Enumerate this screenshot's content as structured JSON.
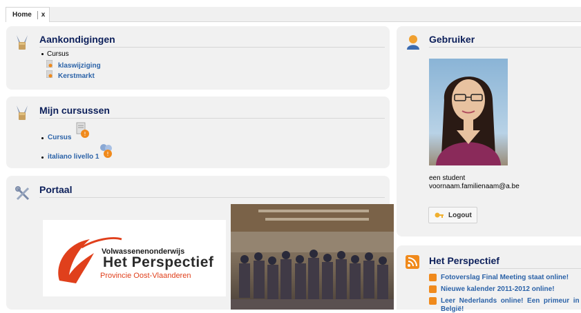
{
  "tabs": {
    "home_label": "Home",
    "close_label": "x"
  },
  "announcements": {
    "title": "Aankondigingen",
    "category": "Cursus",
    "items": [
      {
        "label": "klaswijziging"
      },
      {
        "label": "Kerstmarkt"
      }
    ]
  },
  "my_courses": {
    "title": "Mijn cursussen",
    "items": [
      {
        "label": "Cursus"
      },
      {
        "label": "italiano livello 1"
      }
    ]
  },
  "portal": {
    "title": "Portaal",
    "logo_line1": "Volwassenenonderwijs",
    "logo_line2": "Het Perspectief",
    "logo_line3": "Provincie Oost-Vlaanderen"
  },
  "user": {
    "title": "Gebruiker",
    "name": "een student",
    "email": "voornaam.familienaam@a.be",
    "logout_label": "Logout"
  },
  "feed": {
    "title": "Het Perspectief",
    "items": [
      {
        "label": "Fotoverslag Final Meeting staat online!"
      },
      {
        "label": "Nieuwe kalender 2011-2012 online!"
      },
      {
        "label": "Leer  Nederlands  online!  Een  primeur  in"
      },
      {
        "label": "België!"
      }
    ]
  },
  "colors": {
    "title": "#0c1f5a",
    "link": "#2c63a8",
    "panel_bg": "#f1f1f1",
    "logo_red": "#e0401c",
    "rss": "#f08a1c"
  }
}
